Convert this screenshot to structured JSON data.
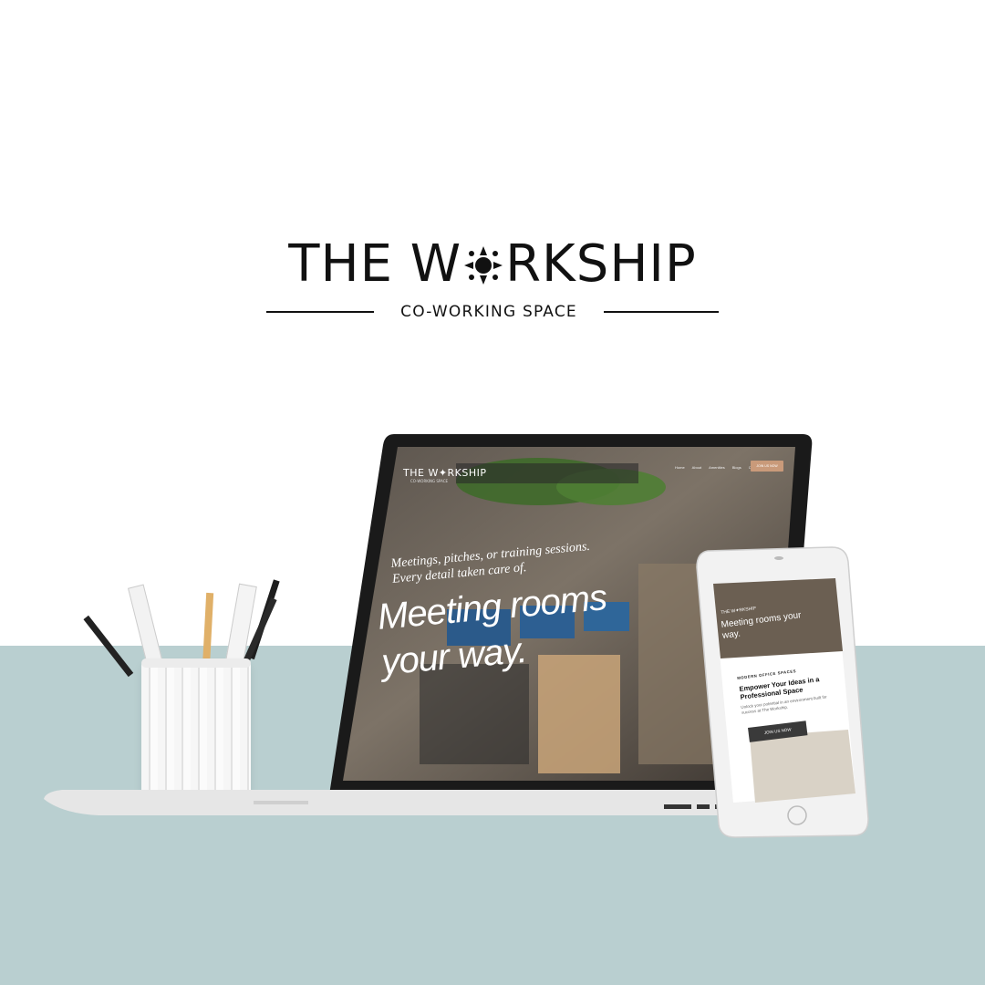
{
  "brand": {
    "title_part1": "THE W",
    "title_part2": "RKSHIP",
    "subtitle": "CO-WORKING SPACE"
  },
  "website": {
    "logo": "THE W✦RKSHIP",
    "logo_sub": "CO-WORKING SPACE",
    "nav": [
      "Home",
      "About",
      "Amenities",
      "Blogs",
      "Contact us"
    ],
    "cta": "JOIN US NOW",
    "hero_kicker": "Meetings, pitches, or training sessions. Every detail taken care of.",
    "hero_title": "Meeting rooms your way."
  },
  "mobile": {
    "top_line": "THE W✦RKSHIP",
    "hero": "Meeting rooms your way.",
    "section_label": "MODERN OFFICE SPACES",
    "heading": "Empower Your Ideas in a Professional Space",
    "body": "Unlock your potential in an environment built for success at The Workship.",
    "button": "JOIN US NOW"
  },
  "colors": {
    "desk": "#b9cfd0",
    "accent_cta": "#c99a7a"
  }
}
